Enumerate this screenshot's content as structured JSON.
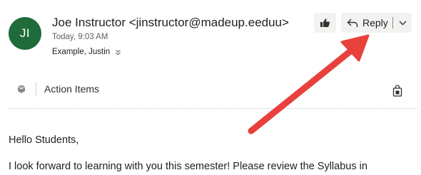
{
  "header": {
    "avatar_initials": "JI",
    "avatar_color": "#1f6b3a",
    "sender": "Joe Instructor <jinstructor@madeup.eeduu>",
    "sent_time": "Today, 9:03 AM",
    "recipients": "Example, Justin"
  },
  "toolbar": {
    "like_icon": "thumbs-up-icon",
    "reply_label": "Reply",
    "reply_icon": "reply-arrow-icon",
    "more_icon": "chevron-down-icon"
  },
  "action_bar": {
    "label": "Action Items"
  },
  "message": {
    "greeting": "Hello Students,",
    "line1": "I look forward to learning with you this semester! Please review the Syllabus in"
  },
  "annotation": {
    "arrow_color": "#e8413c"
  }
}
